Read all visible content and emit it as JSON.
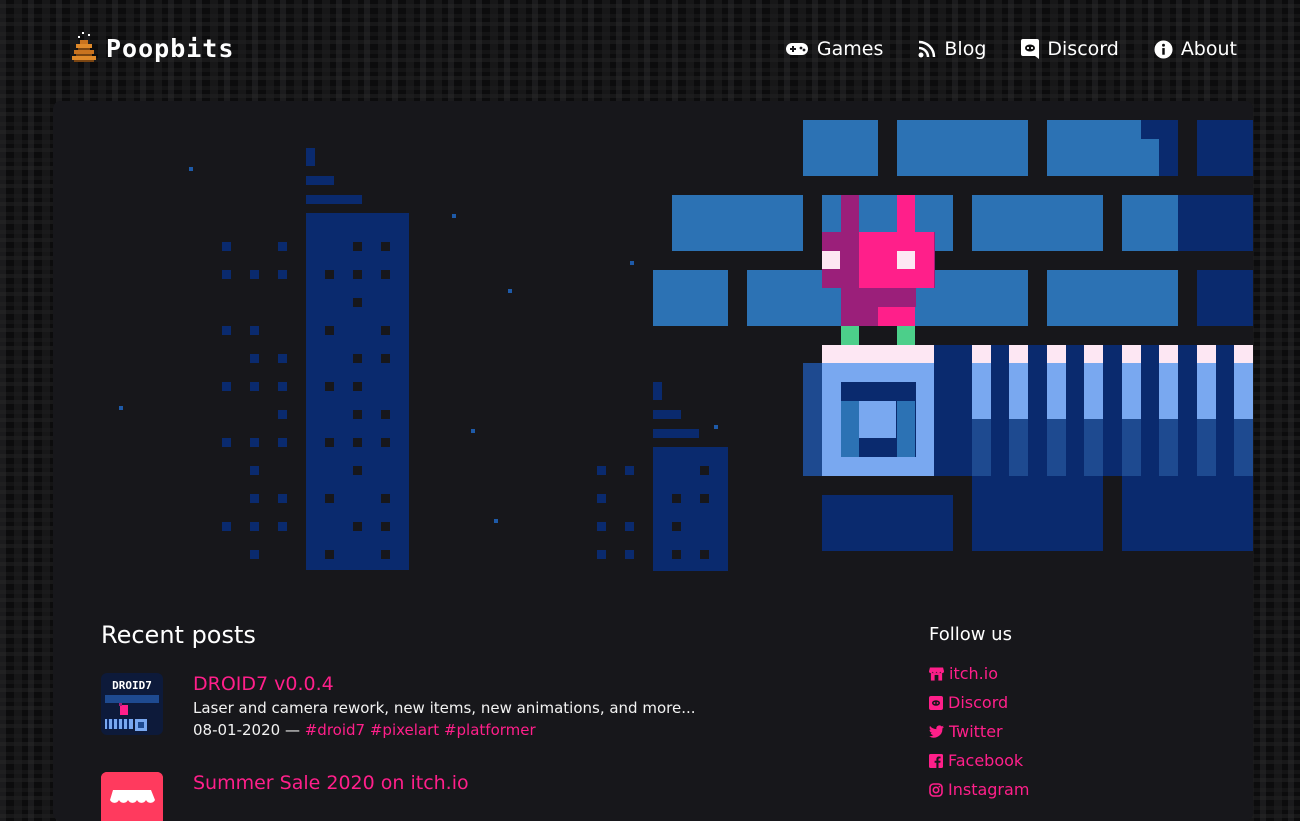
{
  "site": {
    "name": "Poopbits"
  },
  "nav": [
    {
      "label": "Games",
      "icon": "gamepad-icon"
    },
    {
      "label": "Blog",
      "icon": "rss-icon"
    },
    {
      "label": "Discord",
      "icon": "discord-icon"
    },
    {
      "label": "About",
      "icon": "info-icon"
    }
  ],
  "recent_posts": {
    "heading": "Recent posts",
    "items": [
      {
        "thumb_text": "DROID7",
        "title": "DROID7 v0.0.4",
        "excerpt": "Laser and camera rework, new items, new animations, and more...",
        "date": "08-01-2020",
        "separator": " — ",
        "tags": [
          "#droid7",
          "#pixelart",
          "#platformer"
        ]
      },
      {
        "title": "Summer Sale 2020 on itch.io"
      }
    ]
  },
  "follow": {
    "heading": "Follow us",
    "links": [
      {
        "label": "itch.io",
        "icon": "store-icon"
      },
      {
        "label": "Discord",
        "icon": "discord-icon"
      },
      {
        "label": "Twitter",
        "icon": "twitter-icon"
      },
      {
        "label": "Facebook",
        "icon": "facebook-icon"
      },
      {
        "label": "Instagram",
        "icon": "instagram-icon"
      }
    ]
  },
  "colors": {
    "accent": "#ff1f8a",
    "card_bg": "#17171b",
    "page_bg": "#0c0c0d"
  }
}
